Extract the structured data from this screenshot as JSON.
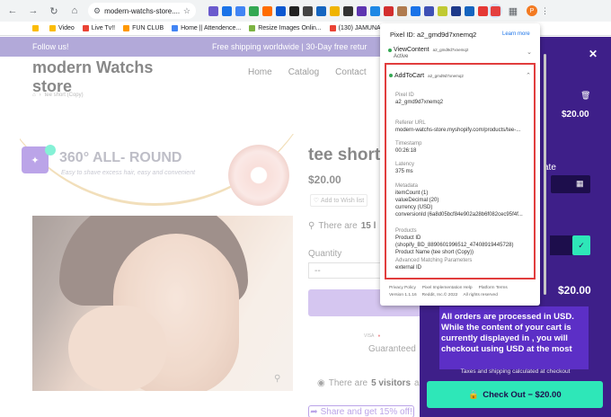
{
  "browser": {
    "url": "modern-watchs-store....",
    "avatar_letter": "P",
    "extension_colors": [
      "#6a5acd",
      "#1a73e8",
      "#4285f4",
      "#34a853",
      "#ff6d00",
      "#0b57d0",
      "#222222",
      "#444444",
      "#1565c0",
      "#f0b400",
      "#333333",
      "#5e35b1",
      "#1e88e5",
      "#d32f2f",
      "#b07b4f",
      "#1a73e8",
      "#3f51b5",
      "#c0ca33",
      "#1e3a8a",
      "#1565c0",
      "#e53935"
    ]
  },
  "bookmarks": [
    {
      "label": "Video",
      "color": "#fbbc04"
    },
    {
      "label": "Live Tv!!",
      "color": "#ea4335"
    },
    {
      "label": "FUN CLUB",
      "color": "#ff9800"
    },
    {
      "label": "Home || Attendence...",
      "color": "#4285f4"
    },
    {
      "label": "Resize Images Onlin...",
      "color": "#7cb342"
    },
    {
      "label": "(130) JAMUNA TV LI...",
      "color": "#ea4335"
    }
  ],
  "store": {
    "announcement_left": "Follow us!",
    "announcement_right": "Free shipping worldwide | 30-Day free retur",
    "logo": "modern Watchs store",
    "nav": [
      "Home",
      "Catalog",
      "Contact"
    ],
    "breadcrumb": "tee short (Copy)",
    "banner_title": "360° ALL- ROUND",
    "banner_sub": "Easy to shave excess hair, easy and convenient",
    "product_title": "tee short",
    "price": "$20.00",
    "wishlist": "Add to Wish list",
    "viewers_prefix": "There are",
    "viewers_top_count": "15 l",
    "quantity_label": "Quantity",
    "quantity_value": "--",
    "pay_label": "VISA",
    "guarantee": "Guaranteed",
    "viewers_bottom_count": "5 visitors",
    "viewers_bottom_suffix": "are",
    "share": "Share and get 15% off!"
  },
  "cart": {
    "close": "✕",
    "item_price": "$20.00",
    "date_label": "ate",
    "subtotal": "$20.00",
    "notice": "All orders are processed in USD. While the content of your cart is currently displayed in , you will checkout using USD at the most",
    "footer_note": "Taxes and shipping calculated at checkout",
    "checkout": "Check Out − $20.00"
  },
  "popup": {
    "pixel_id_label": "Pixel ID: a2_gmd9d7xnemq2",
    "learn_more": "Learn more",
    "event1": {
      "name": "ViewContent",
      "id": "a2_gmd9d7xnemq2",
      "status": "Active"
    },
    "event2": {
      "name": "AddToCart",
      "id": "a2_gmd9d7xnemq2",
      "fields": [
        {
          "label": "Pixel ID",
          "lines": [
            "a2_gmd9d7xnemq2"
          ]
        },
        {
          "label": "Referer URL",
          "lines": [
            "modern-watchs-store.myshopify.com/products/tee-..."
          ]
        },
        {
          "label": "Timestamp",
          "lines": [
            "00:26:18"
          ]
        },
        {
          "label": "Latency",
          "lines": [
            "375 ms"
          ]
        },
        {
          "label": "Metadata",
          "lines": [
            "itemCount (1)",
            "valueDecimal (20)",
            "currency (USD)",
            "conversionId (6a8d05bcf84e902a28b6f082cec95f4f..."
          ]
        },
        {
          "label": "Products",
          "lines": [
            "Product ID",
            "(shopify_BD_8890601996512_47408919445728)",
            "Product Name (tee short (Copy))"
          ]
        },
        {
          "label": "Advanced Matching Parameters",
          "lines": [
            "external ID"
          ]
        }
      ]
    },
    "footer_links": [
      "Privacy Policy",
      "Pixel Implementation Help",
      "Platform Terms"
    ],
    "version": "Version 1.1.16",
    "copyright": "Reddit, Inc.© 2022",
    "rights": "All rights reserved"
  }
}
